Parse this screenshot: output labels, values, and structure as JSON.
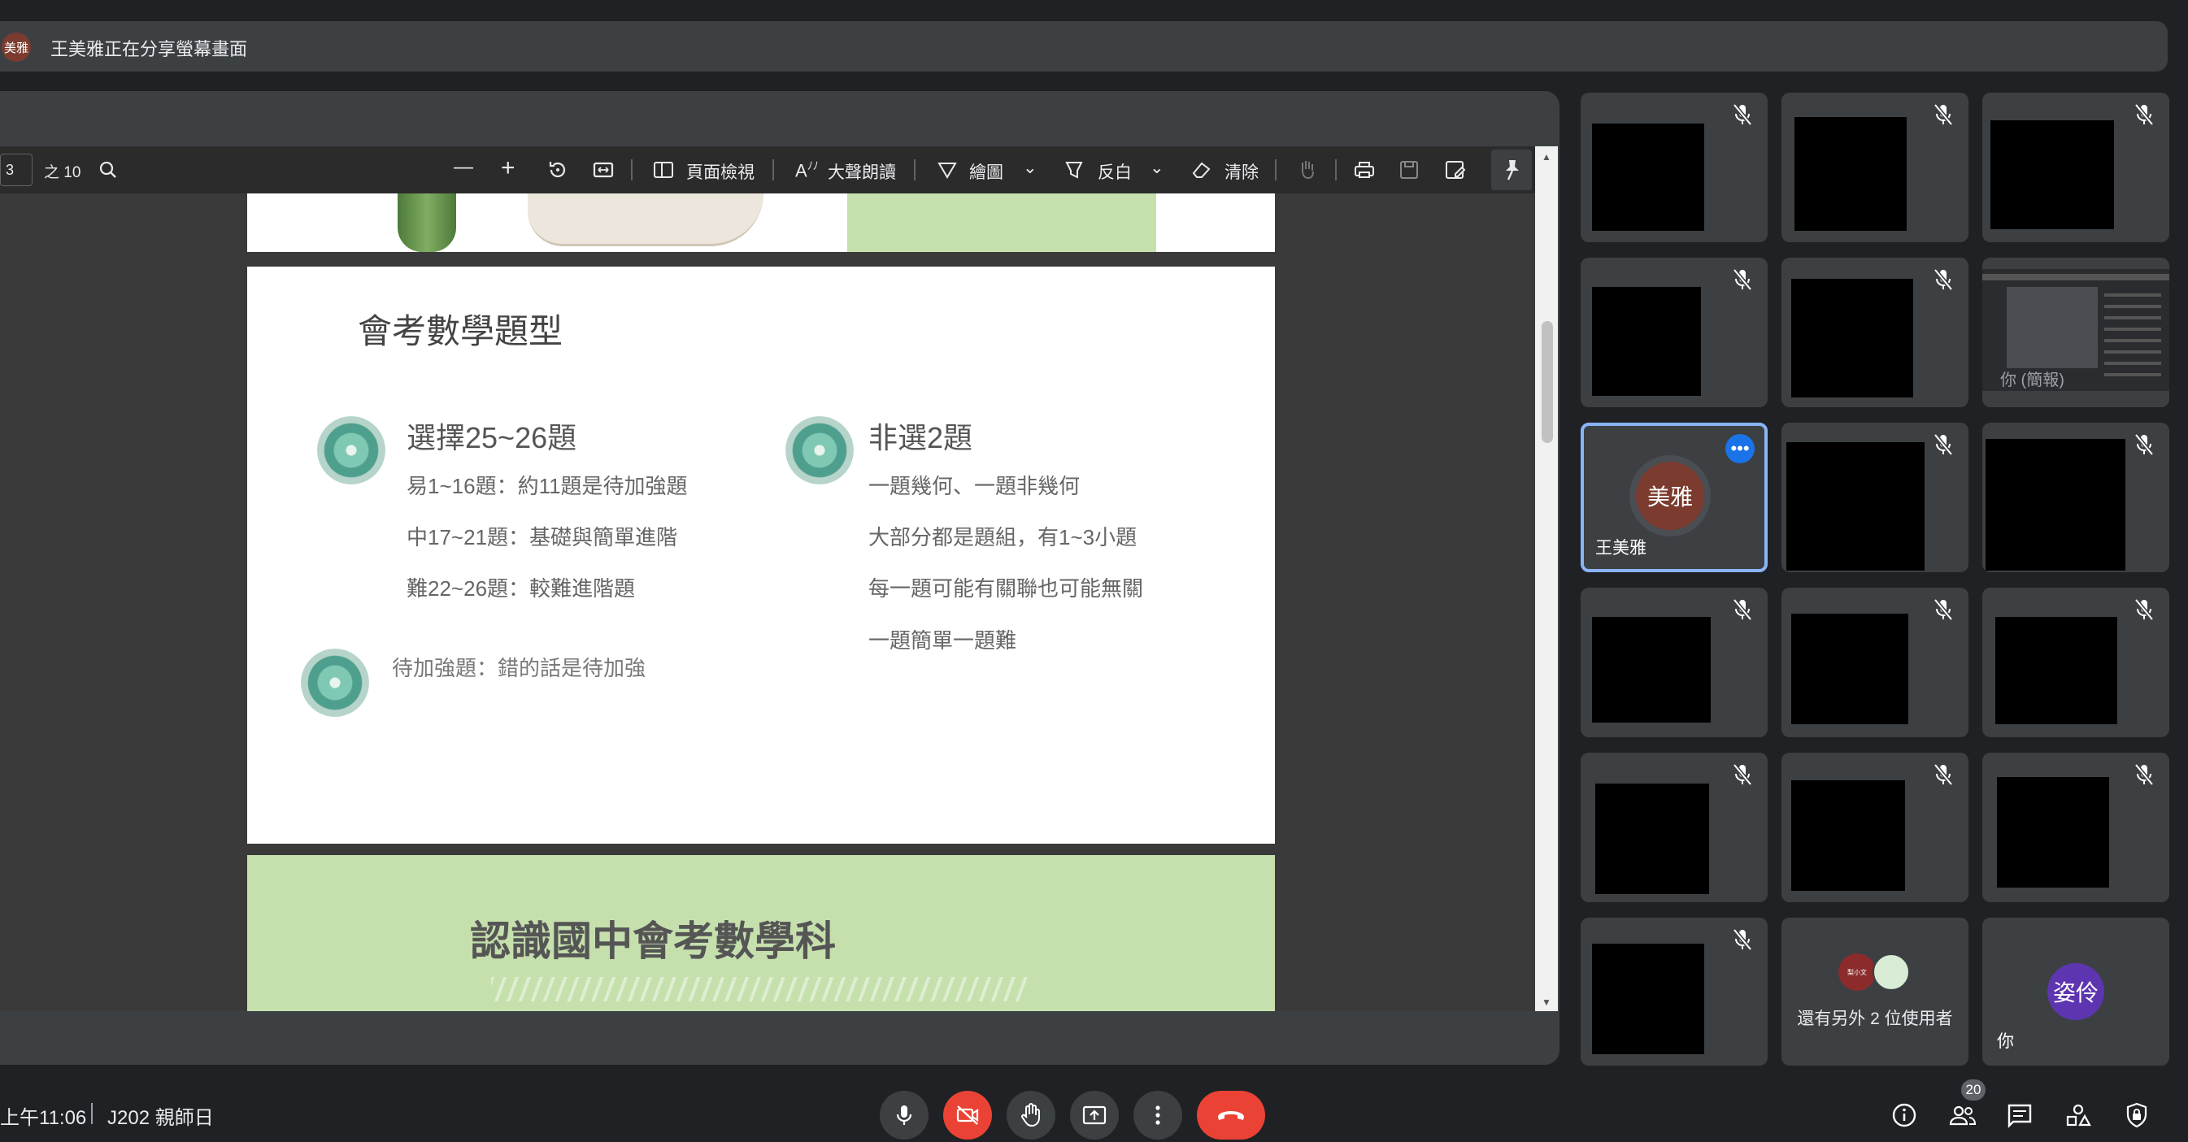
{
  "banner": {
    "avatar": "美雅",
    "text": "王美雅正在分享螢幕畫面"
  },
  "pdf_toolbar": {
    "page_number": "3",
    "page_total": "之 10",
    "page_view_label": "頁面檢視",
    "read_aloud_label": "大聲朗讀",
    "draw_label": "繪圖",
    "highlight_label": "反白",
    "erase_label": "清除"
  },
  "slide_main": {
    "title": "會考數學題型",
    "left_heading": "選擇25~26題",
    "left_items": [
      "易1~16題：約11題是待加強題",
      "中17~21題：基礎與簡單進階",
      "難22~26題：較難進階題"
    ],
    "note": "待加強題：錯的話是待加強",
    "right_heading": "非選2題",
    "right_items": [
      "一題幾何、一題非幾何",
      "大部分都是題組，有1~3小題",
      "每一題可能有關聯也可能無關",
      "一題簡單一題難"
    ]
  },
  "slide_next": {
    "title": "認識國中會考數學科"
  },
  "participants": {
    "presenter_avatar": "美雅",
    "presenter_name": "王美雅",
    "others_text": "還有另外 2 位使用者",
    "self_avatar": "姿伶",
    "self_name": "你",
    "self_preview_label": "你 (簡報)",
    "mini_avatar": "梨小文"
  },
  "bottombar": {
    "time": "上午11:06",
    "meeting": "J202 親師日",
    "people_count": "20"
  },
  "colors": {
    "end_call": "#ea4335",
    "camera_off": "#ea4335",
    "active_border": "#8ab4f8",
    "self_avatar": "#5e35b1",
    "presenter_avatar": "#7b3b2e"
  }
}
